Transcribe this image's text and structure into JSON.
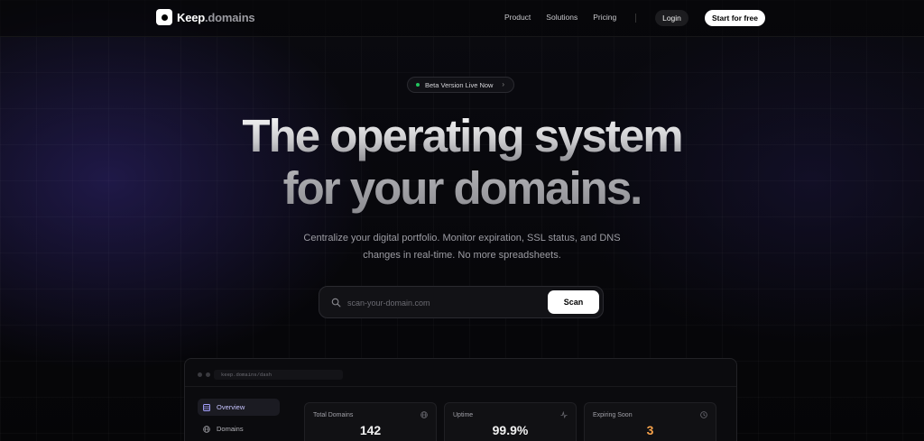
{
  "brand": {
    "name": "Keep",
    "suffix": ".domains"
  },
  "nav": {
    "links": [
      "Product",
      "Solutions",
      "Pricing"
    ],
    "login_label": "Login",
    "cta_label": "Start for free"
  },
  "hero": {
    "badge": "Beta Version Live Now",
    "headline_line1": "The operating system",
    "headline_line2": "for your domains.",
    "subtitle_line1": "Centralize your digital portfolio. Monitor expiration, SSL status, and DNS",
    "subtitle_line2": "changes in real-time. No more spreadsheets."
  },
  "search": {
    "placeholder": "scan-your-domain.com",
    "button_label": "Scan"
  },
  "dashboard": {
    "url": "keep.domains/dash",
    "sidebar": [
      {
        "label": "Overview",
        "icon": "list-icon",
        "active": true
      },
      {
        "label": "Domains",
        "icon": "globe-icon",
        "active": false
      }
    ],
    "stats": [
      {
        "label": "Total Domains",
        "value": "142",
        "icon": "globe-icon"
      },
      {
        "label": "Uptime",
        "value": "99.9%",
        "icon": "activity-icon"
      },
      {
        "label": "Expiring Soon",
        "value": "3",
        "icon": "clock-icon",
        "accent": "#f5a14a"
      }
    ]
  },
  "colors": {
    "accent_purple": "#c7c4ff",
    "status_green": "#22c55e",
    "warning_orange": "#f5a14a"
  }
}
